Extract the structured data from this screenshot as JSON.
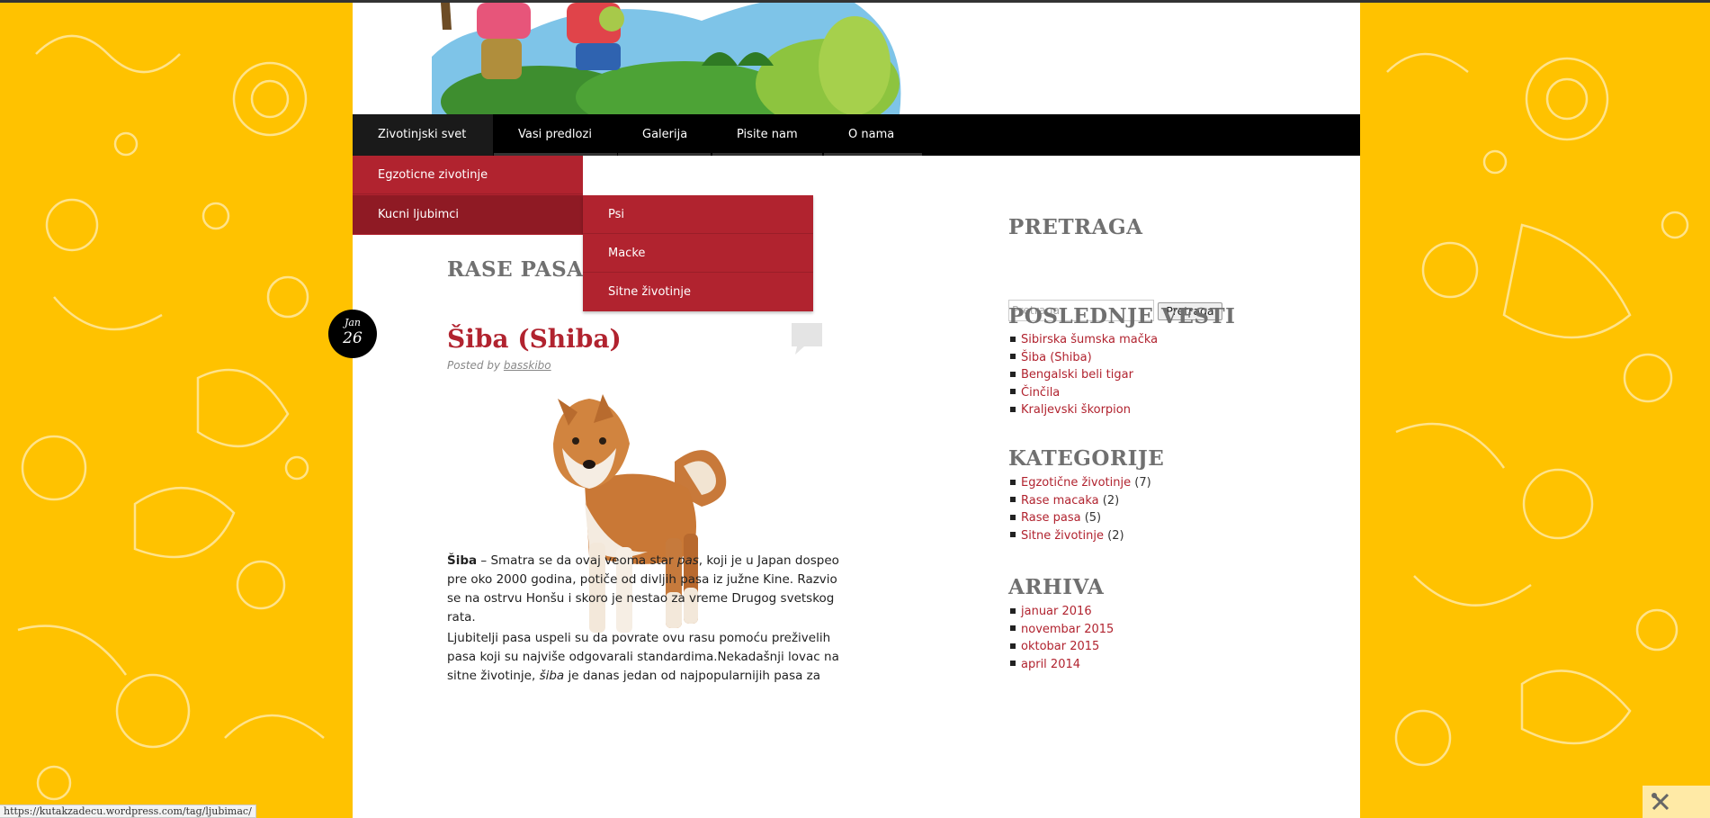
{
  "nav": {
    "items": [
      "Zivotinjski svet",
      "Vasi predlozi",
      "Galerija",
      "Pisite nam",
      "O nama"
    ]
  },
  "dropdown": {
    "level1": [
      "Egzoticne zivotinje",
      "Kucni ljubimci"
    ],
    "level2": [
      "Psi",
      "Macke",
      "Sitne životinje"
    ]
  },
  "archive_title": "RASE PASA",
  "post": {
    "date_month": "Jan",
    "date_day": "26",
    "title": "Šiba (Shiba)",
    "posted_prefix": "Posted by",
    "author": "basskibo",
    "p1_bold": "Šiba",
    "p1_a": " – Smatra se da ovaj veoma star ",
    "p1_em": "pas",
    "p1_b": ", koji je u Japan dospeo pre oko 2000 godina, potiče od divljih pasa iz južne Kine. Razvio se na ostrvu Honšu i skoro je nestao za vreme Drugog svetskog rata.",
    "p2_a": "Ljubitelji pasa uspeli su da povrate ovu rasu pomoću preživelih pasa koji su najviše odgovarali standardima.Nekadašnji lovac na sitne životinje, ",
    "p2_em": "šiba",
    "p2_b": " je danas jedan od najpopularnijih pasa za"
  },
  "sidebar": {
    "search_title": "PRETRAGA",
    "search_placeholder": "Pretraga",
    "search_button": "Pretraga",
    "news_title": "POSLEDNJE VESTI",
    "news": [
      "Sibirska šumska mačka",
      "Šiba (Shiba)",
      "Bengalski beli tigar",
      "Činčila",
      "Kraljevski škorpion"
    ],
    "categories_title": "KATEGORIJE",
    "categories": [
      {
        "name": "Egzotične životinje",
        "count": "(7)"
      },
      {
        "name": "Rase macaka",
        "count": "(2)"
      },
      {
        "name": "Rase pasa",
        "count": "(5)"
      },
      {
        "name": "Sitne životinje",
        "count": "(2)"
      }
    ],
    "archive_title": "ARHIVA",
    "archive": [
      "januar 2016",
      "novembar 2015",
      "oktobar 2015",
      "april 2014"
    ]
  },
  "status_url": "https://kutakzadecu.wordpress.com/tag/ljubimac/",
  "colors": {
    "background": "#FFC200",
    "accent": "#B1232F",
    "nav_bg": "#000000",
    "heading": "#707070"
  },
  "icons": {
    "comment": "comment-bubble-icon",
    "tools": "tools-icon"
  }
}
